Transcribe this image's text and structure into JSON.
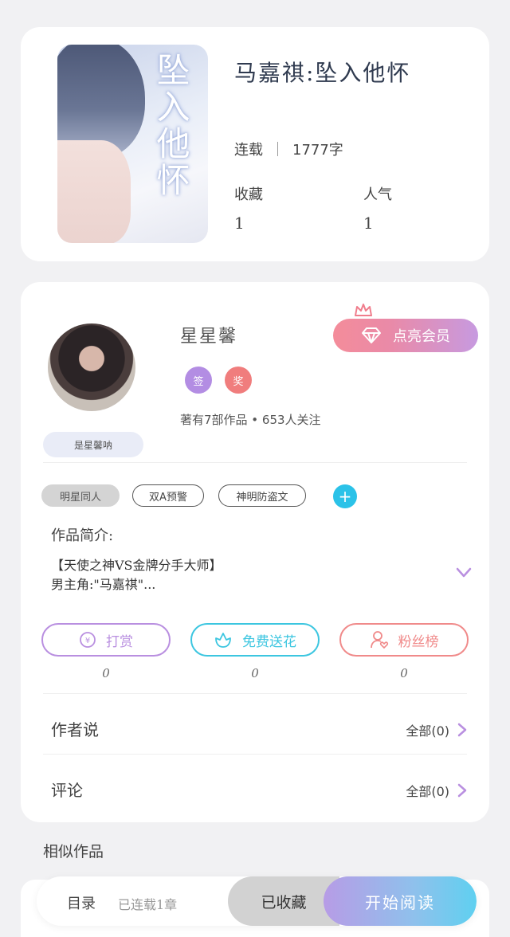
{
  "book": {
    "cover_text": "坠入他怀",
    "title": "马嘉祺:坠入他怀",
    "status": "连载",
    "word_count": "1777字",
    "favorites_label": "收藏",
    "favorites_count": "1",
    "popularity_label": "人气",
    "popularity_count": "1"
  },
  "author": {
    "nickname": "星星馨",
    "badges": [
      {
        "text": "签",
        "color": "#b38de3"
      },
      {
        "text": "奖",
        "color": "#f07d7d"
      }
    ],
    "vip_button": "点亮会员",
    "works_summary": "著有7部作品 • 653人关注",
    "signature": "是星馨呐"
  },
  "tags": [
    "明星同人",
    "双A预警",
    "神明防盗文"
  ],
  "intro": {
    "label": "作品简介:",
    "line1": "【天使之神VS金牌分手大师】",
    "line2": "男主角:\"马嘉祺\"..."
  },
  "actions": [
    {
      "label": "打赏",
      "count": "0",
      "color": "#b98fe0",
      "icon": "coin-icon"
    },
    {
      "label": "免费送花",
      "count": "0",
      "color": "#3cc6e0",
      "icon": "flower-icon"
    },
    {
      "label": "粉丝榜",
      "count": "0",
      "color": "#f08a8a",
      "icon": "fan-icon"
    }
  ],
  "author_says": {
    "label": "作者说",
    "right": "全部(0)"
  },
  "comments": {
    "label": "评论",
    "right": "全部(0)"
  },
  "similar_label": "相似作品",
  "bottom_bar": {
    "toc": "目录",
    "toc_sub": "已连载1章",
    "favorited": "已收藏",
    "start_read": "开始阅读"
  }
}
